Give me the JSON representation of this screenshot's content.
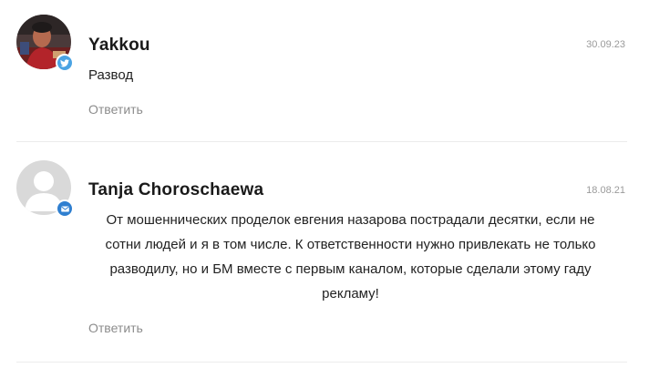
{
  "comments": [
    {
      "author": "Yakkou",
      "date": "30.09.23",
      "text": "Развод",
      "reply_label": "Ответить",
      "avatar_icon": "user-photo",
      "source_icon": "twitter-bird-icon",
      "source_color": "#4aa3e3"
    },
    {
      "author": "Tanja Choroschaewa",
      "date": "18.08.21",
      "text": "От мошеннических проделок евгения назарова пострадали десятки, если не сотни людей и я в том числе. К ответственности нужно привлекать не только разводилу, но и БМ вместе с первым каналом, которые сделали этому гаду рекламу!",
      "reply_label": "Ответить",
      "avatar_icon": "default-avatar-icon",
      "source_icon": "email-envelope-icon",
      "source_color": "#2f7fd0"
    }
  ]
}
